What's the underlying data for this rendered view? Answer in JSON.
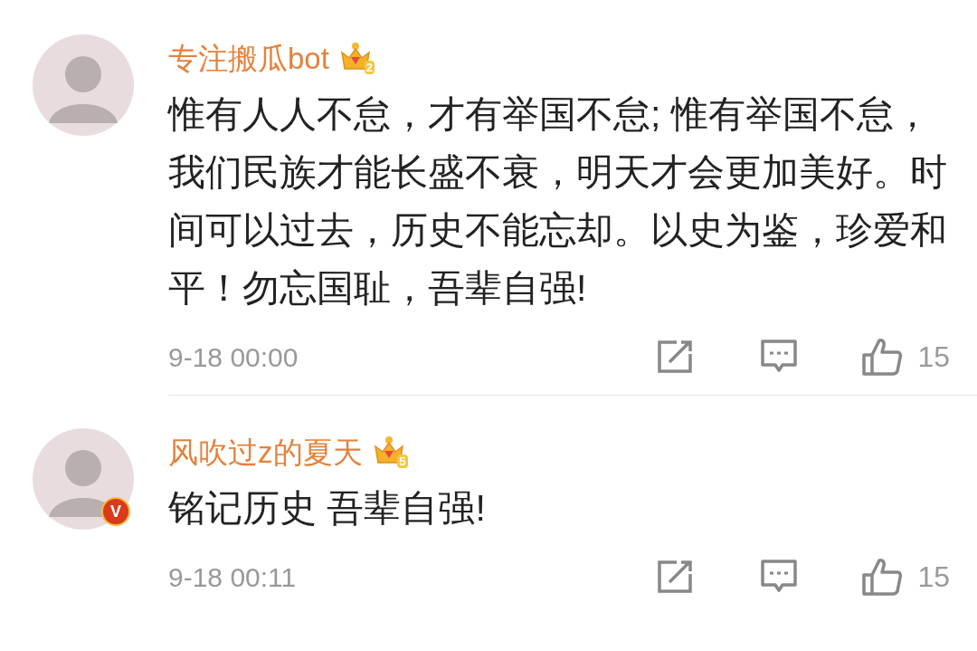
{
  "comments": [
    {
      "user": "专注搬瓜bot",
      "badge_level": "2",
      "verified": false,
      "text": "惟有人人不怠，才有举国不怠; 惟有举国不怠，我们民族才能长盛不衰，明天才会更加美好。时间可以过去，历史不能忘却。以史为鉴，珍爱和平！勿忘国耻，吾辈自强!",
      "time": "9-18 00:00",
      "likes": "15"
    },
    {
      "user": "风吹过z的夏天",
      "badge_level": "5",
      "verified": true,
      "verified_label": "V",
      "text": "铭记历史 吾辈自强!",
      "time": "9-18 00:11",
      "likes": "15"
    }
  ]
}
